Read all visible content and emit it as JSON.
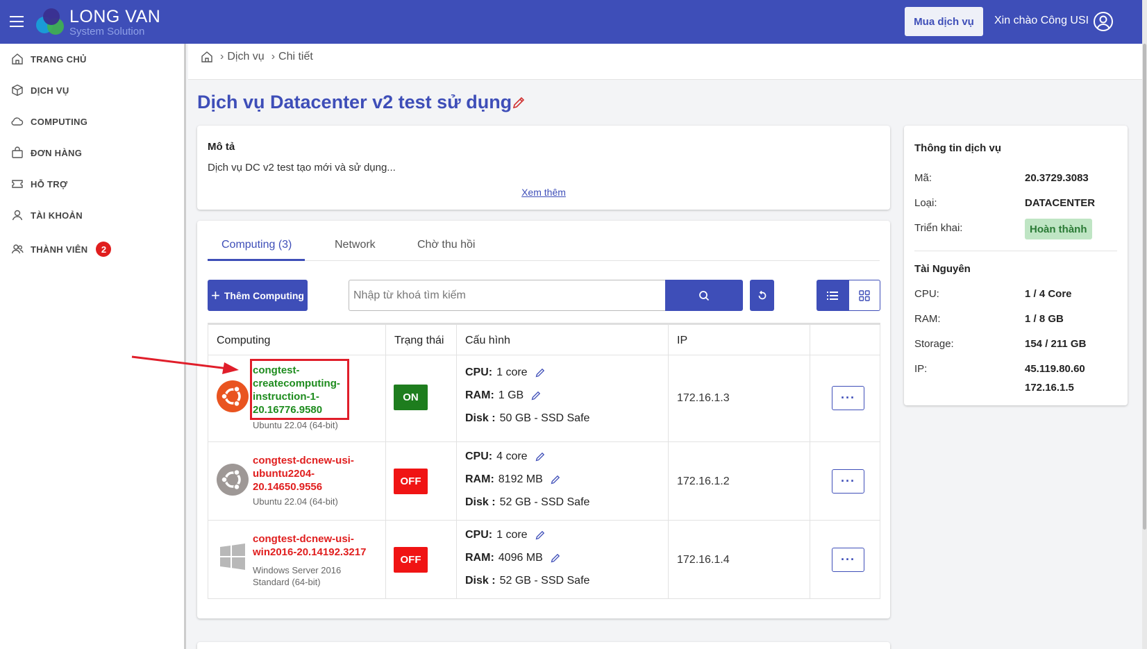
{
  "header": {
    "brand_name": "LONG VAN",
    "brand_sub": "System Solution",
    "buy_label": "Mua dịch vụ",
    "greeting": "Xin chào Công USI"
  },
  "sidebar": {
    "items": [
      {
        "label": "TRANG CHỦ",
        "icon": "home-icon"
      },
      {
        "label": "DỊCH VỤ",
        "icon": "cube-icon"
      },
      {
        "label": "COMPUTING",
        "icon": "cloud-icon"
      },
      {
        "label": "ĐƠN HÀNG",
        "icon": "bag-icon"
      },
      {
        "label": "HỖ TRỢ",
        "icon": "ticket-icon"
      },
      {
        "label": "TÀI KHOẢN",
        "icon": "user-icon"
      },
      {
        "label": "THÀNH VIÊN",
        "icon": "users-icon",
        "badge": "2"
      }
    ]
  },
  "breadcrumb": {
    "items": [
      "Dịch vụ",
      "Chi tiết"
    ]
  },
  "page": {
    "title": "Dịch vụ Datacenter v2 test sử dụng"
  },
  "description": {
    "title": "Mô tả",
    "text": "Dịch vụ DC v2 test tạo mới và sử dụng...",
    "more": "Xem thêm"
  },
  "tabs": [
    {
      "label": "Computing (3)",
      "active": true
    },
    {
      "label": "Network",
      "active": false
    },
    {
      "label": "Chờ thu hồi",
      "active": false
    }
  ],
  "toolbar": {
    "add_label": "Thêm Computing",
    "search_placeholder": "Nhập từ khoá tìm kiếm"
  },
  "table": {
    "headers": [
      "Computing",
      "Trạng thái",
      "Cấu hình",
      "IP",
      ""
    ],
    "cfg_keys": {
      "cpu": "CPU:",
      "ram": "RAM:",
      "disk": "Disk :"
    },
    "more_label": "···",
    "rows": [
      {
        "name_lines": [
          "congtest-",
          "createcomputing-",
          "instruction-1-",
          "20.16776.9580"
        ],
        "os_lines": [
          "Ubuntu 22.04 (64-bit)"
        ],
        "os_icon": "ubuntu-icon",
        "status": "ON",
        "cpu": "1 core",
        "ram": "1 GB",
        "disk": "50 GB - SSD Safe",
        "ip": "172.16.1.3"
      },
      {
        "name_lines": [
          "congtest-dcnew-usi-",
          "ubuntu2204-",
          "20.14650.9556"
        ],
        "os_lines": [
          "Ubuntu 22.04 (64-bit)"
        ],
        "os_icon": "ubuntu-gray-icon",
        "status": "OFF",
        "cpu": "4 core",
        "ram": "8192 MB",
        "disk": "52 GB - SSD Safe",
        "ip": "172.16.1.2"
      },
      {
        "name_lines": [
          "congtest-dcnew-usi-",
          "win2016-20.14192.3217"
        ],
        "os_lines": [
          "Windows Server 2016",
          "Standard (64-bit)"
        ],
        "os_icon": "windows-icon",
        "status": "OFF",
        "cpu": "1 core",
        "ram": "4096 MB",
        "disk": "52 GB - SSD Safe",
        "ip": "172.16.1.4"
      }
    ]
  },
  "info": {
    "title": "Thông tin dịch vụ",
    "ma_label": "Mã:",
    "ma": "20.3729.3083",
    "loai_label": "Loại:",
    "loai": "DATACENTER",
    "trienkhai_label": "Triển khai:",
    "trienkhai": "Hoàn thành",
    "res_title": "Tài Nguyên",
    "cpu_label": "CPU:",
    "cpu": "1 / 4 Core",
    "ram_label": "RAM:",
    "ram": "1 / 8 GB",
    "storage_label": "Storage:",
    "storage": "154 / 211 GB",
    "ip_label": "IP:",
    "ip1": "45.119.80.60",
    "ip2": "172.16.1.5"
  },
  "colors": {
    "primary": "#3e4eb8",
    "on": "#1e7d1e",
    "off": "#f01414",
    "annotation": "#e01e2a"
  }
}
